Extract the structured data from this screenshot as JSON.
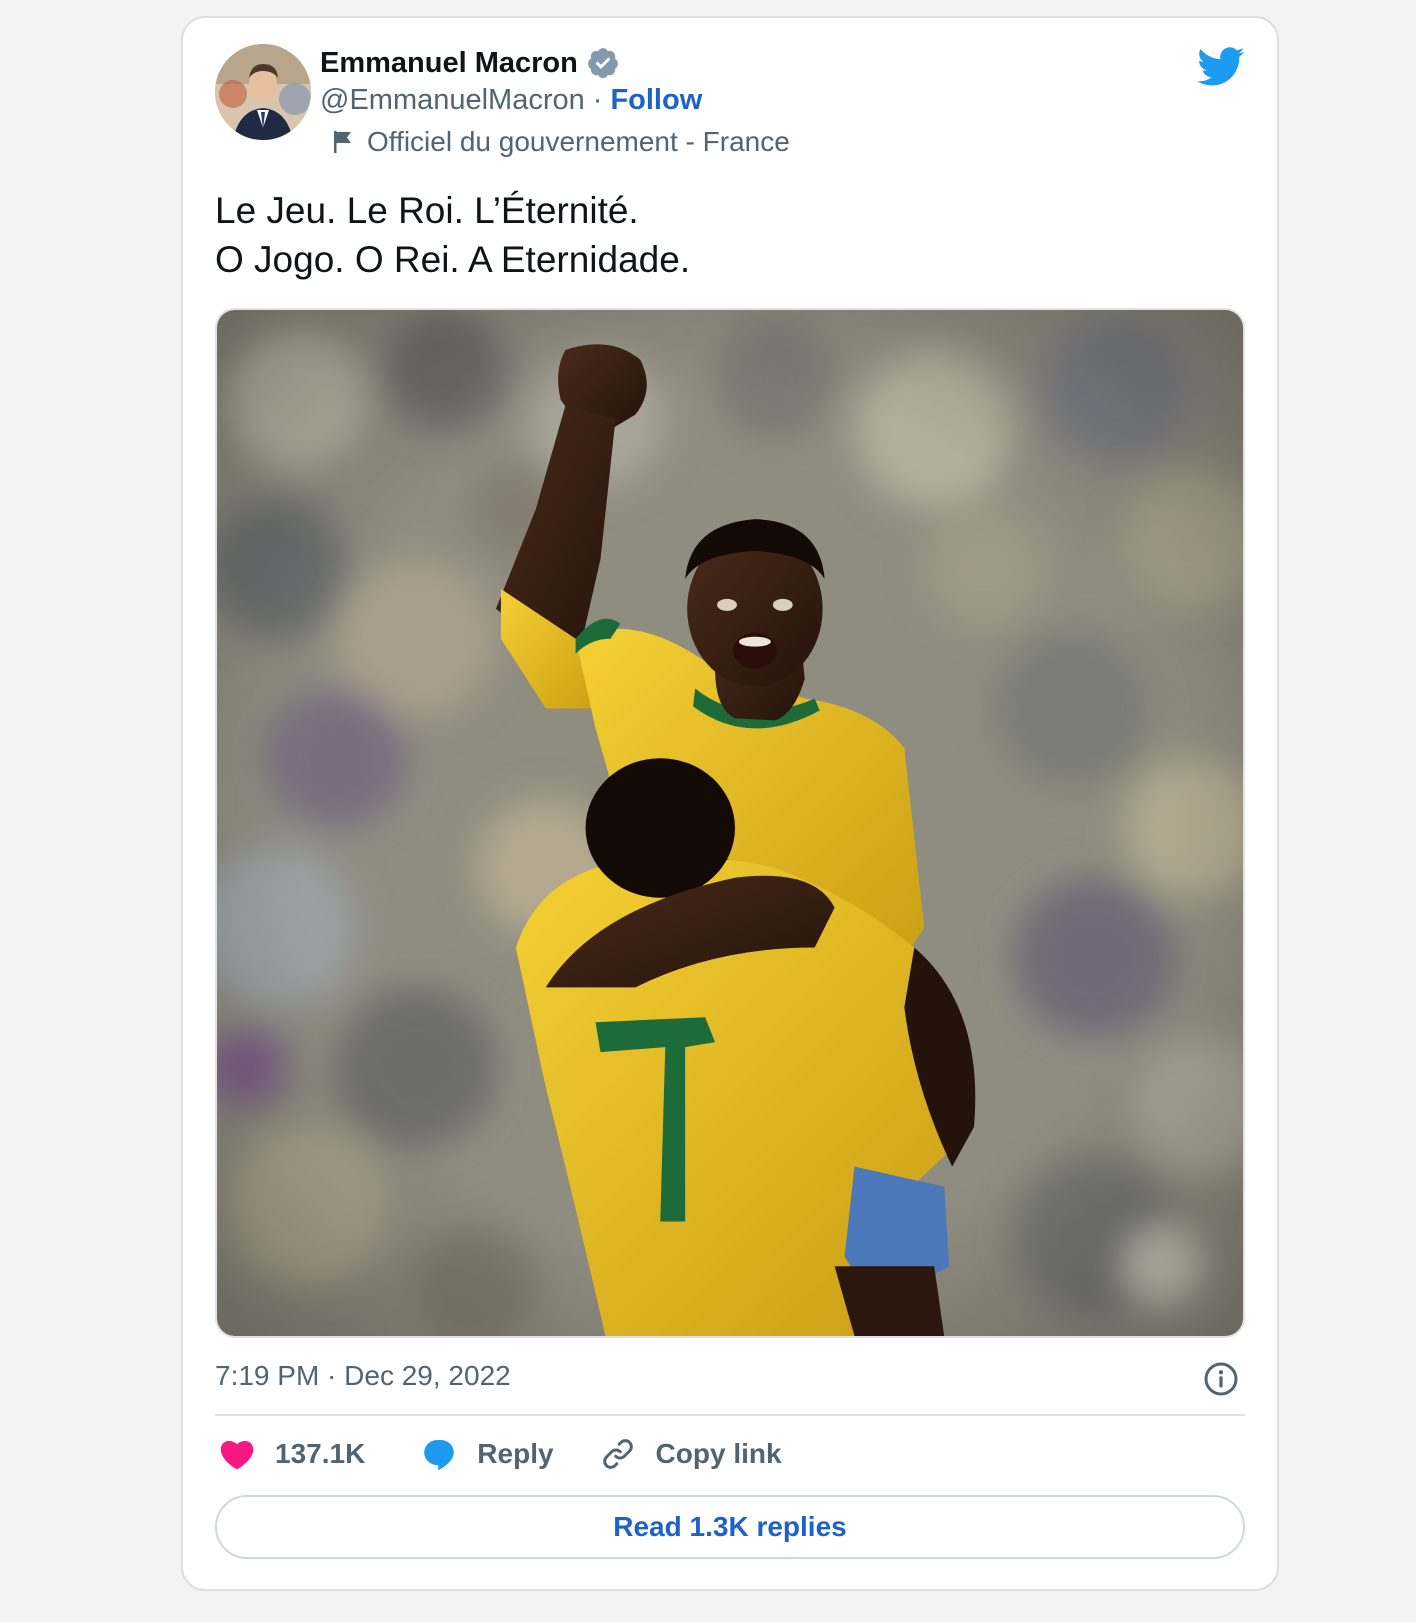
{
  "author": {
    "name": "Emmanuel Macron",
    "handle": "@EmmanuelMacron",
    "separator": "·",
    "follow_label": "Follow",
    "account_label": "Officiel du gouvernement - France",
    "verified_icon": "verified-badge-icon",
    "verified_color": "#829aab"
  },
  "tweet": {
    "lines": [
      "Le Jeu. Le Roi. L’Éternité.",
      "O Jogo. O Rei. A Eternidade."
    ],
    "timestamp": "7:19 PM · Dec 29, 2022"
  },
  "actions": {
    "likes_count": "137.1K",
    "reply_label": "Reply",
    "copy_link_label": "Copy link",
    "read_replies_label": "Read 1.3K replies"
  },
  "colors": {
    "brand_blue": "#1d9bf0",
    "link_blue": "#1d62c9",
    "like_pink": "#f91880",
    "jersey_yellow": "#f0c61e",
    "jersey_green": "#1e6b3a"
  }
}
